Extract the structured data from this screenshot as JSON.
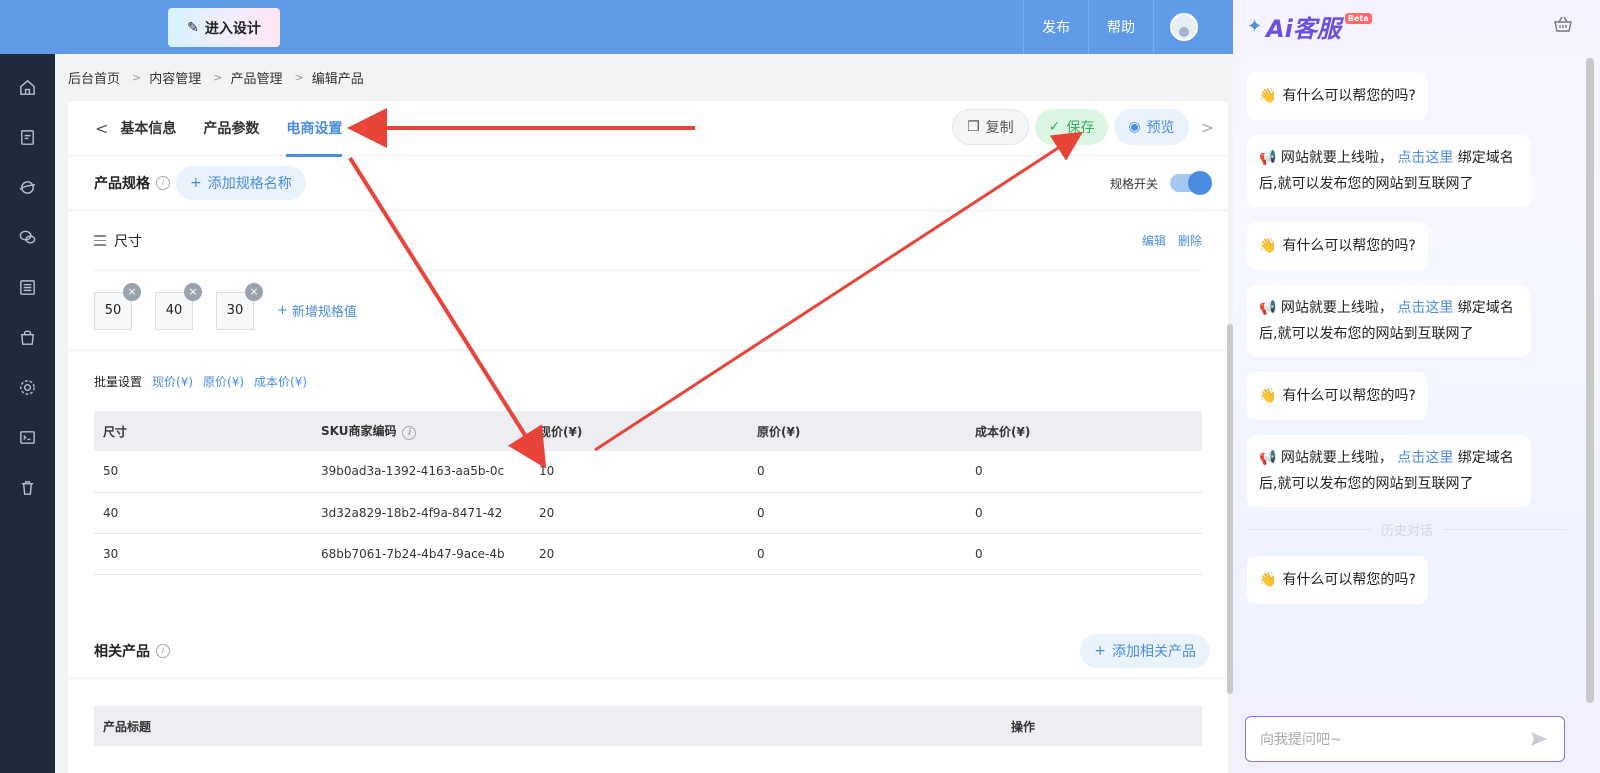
{
  "topbar": {
    "design_btn": "进入设计",
    "nav": [
      "发布",
      "帮助"
    ]
  },
  "sidebar": {
    "items": [
      "home-icon",
      "document-edit-icon",
      "globe-icon",
      "wechat-icon",
      "list-icon",
      "shop-bag-icon",
      "gear-icon",
      "terminal-icon",
      "trash-icon"
    ]
  },
  "breadcrumb": [
    "后台首页",
    "内容管理",
    "产品管理",
    "编辑产品"
  ],
  "tabs": {
    "items": [
      "基本信息",
      "产品参数",
      "电商设置"
    ],
    "active": "电商设置",
    "actions": {
      "copy": "复制",
      "save": "保存",
      "preview": "预览"
    }
  },
  "spec": {
    "title": "产品规格",
    "add_label": "添加规格名称",
    "toggle_label": "规格开关",
    "toggle_on": true,
    "dimension": {
      "name": "尺寸",
      "edit": "编辑",
      "delete": "删除",
      "values": [
        "50",
        "40",
        "30"
      ],
      "add_value": "新增规格值"
    }
  },
  "batch": {
    "label": "批量设置",
    "links": [
      "现价(¥)",
      "原价(¥)",
      "成本价(¥)"
    ]
  },
  "sku_table": {
    "headers": [
      "尺寸",
      "SKU商家编码",
      "现价(¥)",
      "原价(¥)",
      "成本价(¥)"
    ],
    "rows": [
      [
        "50",
        "39b0ad3a-1392-4163-aa5b-0c",
        "10",
        "0",
        "0"
      ],
      [
        "40",
        "3d32a829-18b2-4f9a-8471-42",
        "20",
        "0",
        "0"
      ],
      [
        "30",
        "68bb7061-7b24-4b47-9ace-4b",
        "20",
        "0",
        "0"
      ]
    ]
  },
  "related": {
    "title": "相关产品",
    "add_label": "添加相关产品",
    "headers": [
      "产品标题",
      "操作"
    ]
  },
  "ai": {
    "title": "Ai客服",
    "beta": "Beta",
    "greeting": "有什么可以帮您的吗?",
    "notice_pre": "网站就要上线啦，",
    "notice_link": "点击这里",
    "notice_post": "绑定域名后,就可以发布您的网站到互联网了",
    "history": "历史对话",
    "input_placeholder": "向我提问吧~"
  }
}
